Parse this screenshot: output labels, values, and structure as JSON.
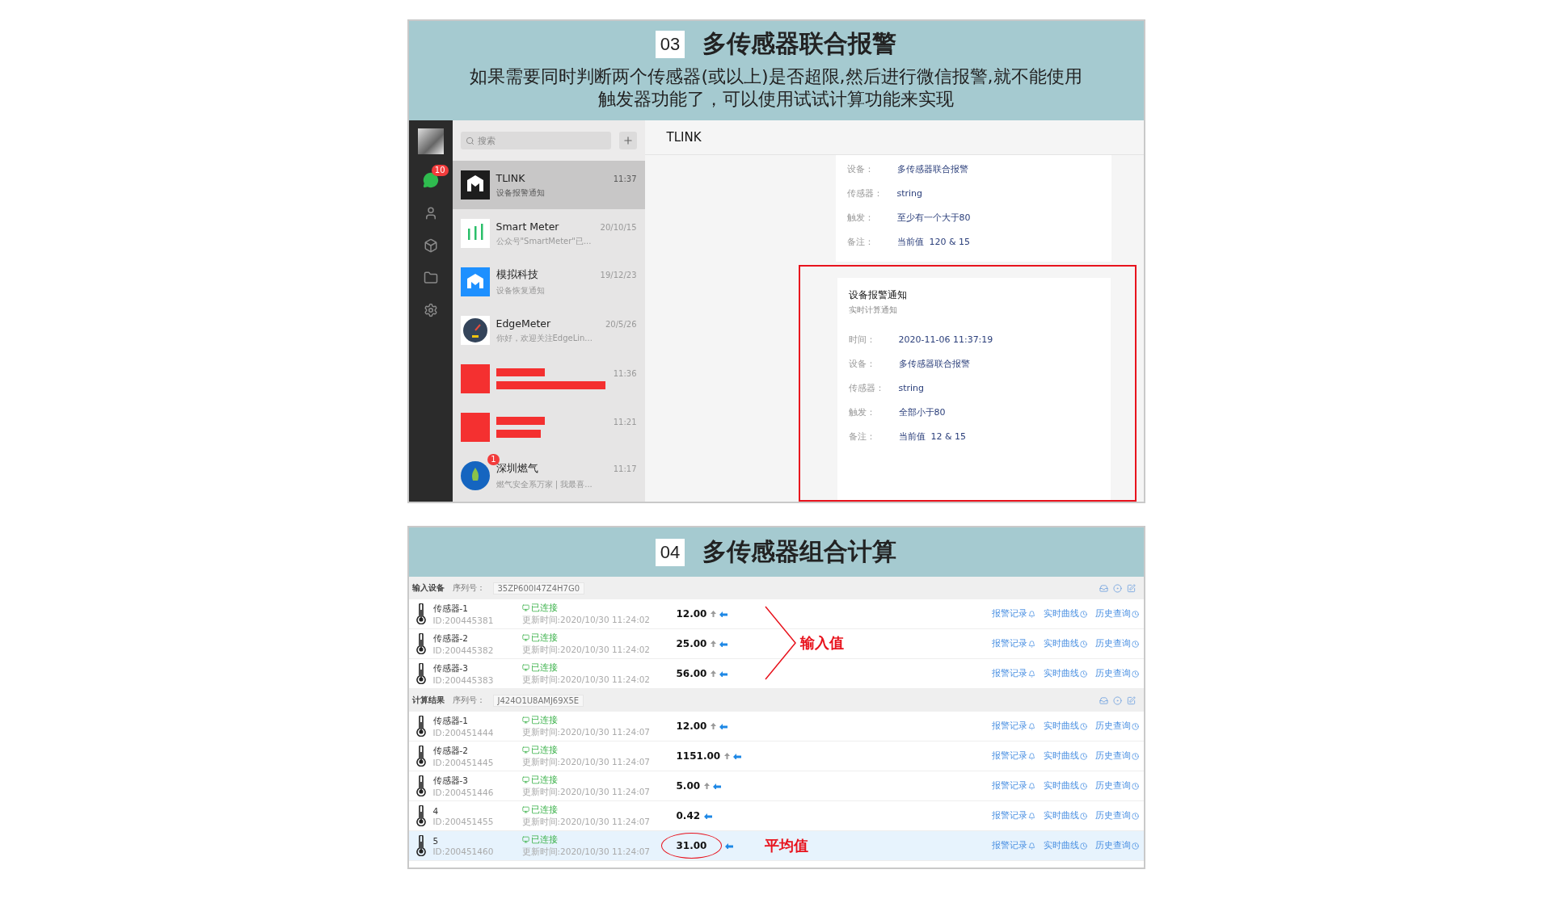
{
  "alarm_panel": {
    "number": "03",
    "title": "多传感器联合报警",
    "description": "如果需要同时判断两个传感器(或以上)是否超限,然后进行微信报警,就不能使用触发器功能了，可以使用试试计算功能来实现",
    "chat_app": {
      "unread_badge": "10",
      "search": {
        "placeholder": "搜索"
      },
      "conversations": [
        {
          "kind": "tlink",
          "name": "TLINK",
          "preview": "设备报警通知",
          "time": "11:37",
          "selected": true
        },
        {
          "kind": "bars",
          "name": "Smart Meter",
          "preview": "公众号\"SmartMeter\"已...",
          "time": "20/10/15",
          "selected": false
        },
        {
          "kind": "house",
          "name": "模拟科技",
          "preview": "设备恢复通知",
          "time": "19/12/23",
          "selected": false
        },
        {
          "kind": "gauge",
          "name": "EdgeMeter",
          "preview": "你好，欢迎关注EdgeLin...",
          "time": "20/5/26",
          "selected": false
        },
        {
          "kind": "redacted",
          "time": "11:36",
          "selected": false
        },
        {
          "kind": "redacted",
          "time": "11:21",
          "selected": false
        },
        {
          "kind": "flame",
          "name": "深圳燃气",
          "preview": "燃气安全系万家 | 我最喜...",
          "time": "11:17",
          "badge": "1",
          "selected": false
        }
      ],
      "chat_title": "TLINK",
      "messages": [
        {
          "highlighted": false,
          "fields": [
            {
              "label": "设备：",
              "value": "多传感器联合报警"
            },
            {
              "label": "传感器：",
              "value": "string"
            },
            {
              "label": "触发：",
              "value": "至少有一个大于80"
            },
            {
              "label": "备注：",
              "value": "当前值  120 & 15"
            }
          ]
        },
        {
          "highlighted": true,
          "title": "设备报警通知",
          "subtitle": "实时计算通知",
          "fields": [
            {
              "label": "时间：",
              "value": "2020-11-06 11:37:19"
            },
            {
              "label": "设备：",
              "value": "多传感器联合报警"
            },
            {
              "label": "传感器：",
              "value": "string"
            },
            {
              "label": "触发：",
              "value": "全部小于80"
            },
            {
              "label": "备注：",
              "value": "当前值  12 & 15"
            }
          ]
        }
      ]
    }
  },
  "calc_panel": {
    "number": "04",
    "title": "多传感器组合计算",
    "groups": [
      {
        "label": "输入设备",
        "serial_label": "序列号：",
        "serial": "35ZP600I47Z4H7G0",
        "annotation": "输入值",
        "rows": [
          {
            "name": "传感器-1",
            "id": "ID:200445381",
            "status": "已连接",
            "updated": "更新时间:2020/10/30 11:24:02",
            "value": "12.00",
            "trend_up": true,
            "selected": false,
            "links": [
              "报警记录",
              "实时曲线",
              "历史查询"
            ]
          },
          {
            "name": "传感器-2",
            "id": "ID:200445382",
            "status": "已连接",
            "updated": "更新时间:2020/10/30 11:24:02",
            "value": "25.00",
            "trend_up": true,
            "selected": false,
            "links": [
              "报警记录",
              "实时曲线",
              "历史查询"
            ]
          },
          {
            "name": "传感器-3",
            "id": "ID:200445383",
            "status": "已连接",
            "updated": "更新时间:2020/10/30 11:24:02",
            "value": "56.00",
            "trend_up": true,
            "selected": false,
            "links": [
              "报警记录",
              "实时曲线",
              "历史查询"
            ]
          }
        ]
      },
      {
        "label": "计算结果",
        "serial_label": "序列号：",
        "serial": "J424O1U8AMJ69X5E",
        "rows": [
          {
            "name": "传感器-1",
            "id": "ID:200451444",
            "status": "已连接",
            "updated": "更新时间:2020/10/30 11:24:07",
            "value": "12.00",
            "trend_up": true,
            "selected": false,
            "links": [
              "报警记录",
              "实时曲线",
              "历史查询"
            ]
          },
          {
            "name": "传感器-2",
            "id": "ID:200451445",
            "status": "已连接",
            "updated": "更新时间:2020/10/30 11:24:07",
            "value": "1151.00",
            "trend_up": true,
            "selected": false,
            "links": [
              "报警记录",
              "实时曲线",
              "历史查询"
            ]
          },
          {
            "name": "传感器-3",
            "id": "ID:200451446",
            "status": "已连接",
            "updated": "更新时间:2020/10/30 11:24:07",
            "value": "5.00",
            "trend_up": true,
            "selected": false,
            "links": [
              "报警记录",
              "实时曲线",
              "历史查询"
            ]
          },
          {
            "name": "4",
            "id": "ID:200451455",
            "status": "已连接",
            "updated": "更新时间:2020/10/30 11:24:07",
            "value": "0.42",
            "trend_up": false,
            "selected": false,
            "links": [
              "报警记录",
              "实时曲线",
              "历史查询"
            ]
          },
          {
            "name": "5",
            "id": "ID:200451460",
            "status": "已连接",
            "updated": "更新时间:2020/10/30 11:24:07",
            "value": "31.00",
            "trend_up": false,
            "selected": true,
            "annotation": "平均值",
            "links": [
              "报警记录",
              "实时曲线",
              "历史查询"
            ]
          }
        ]
      }
    ]
  }
}
